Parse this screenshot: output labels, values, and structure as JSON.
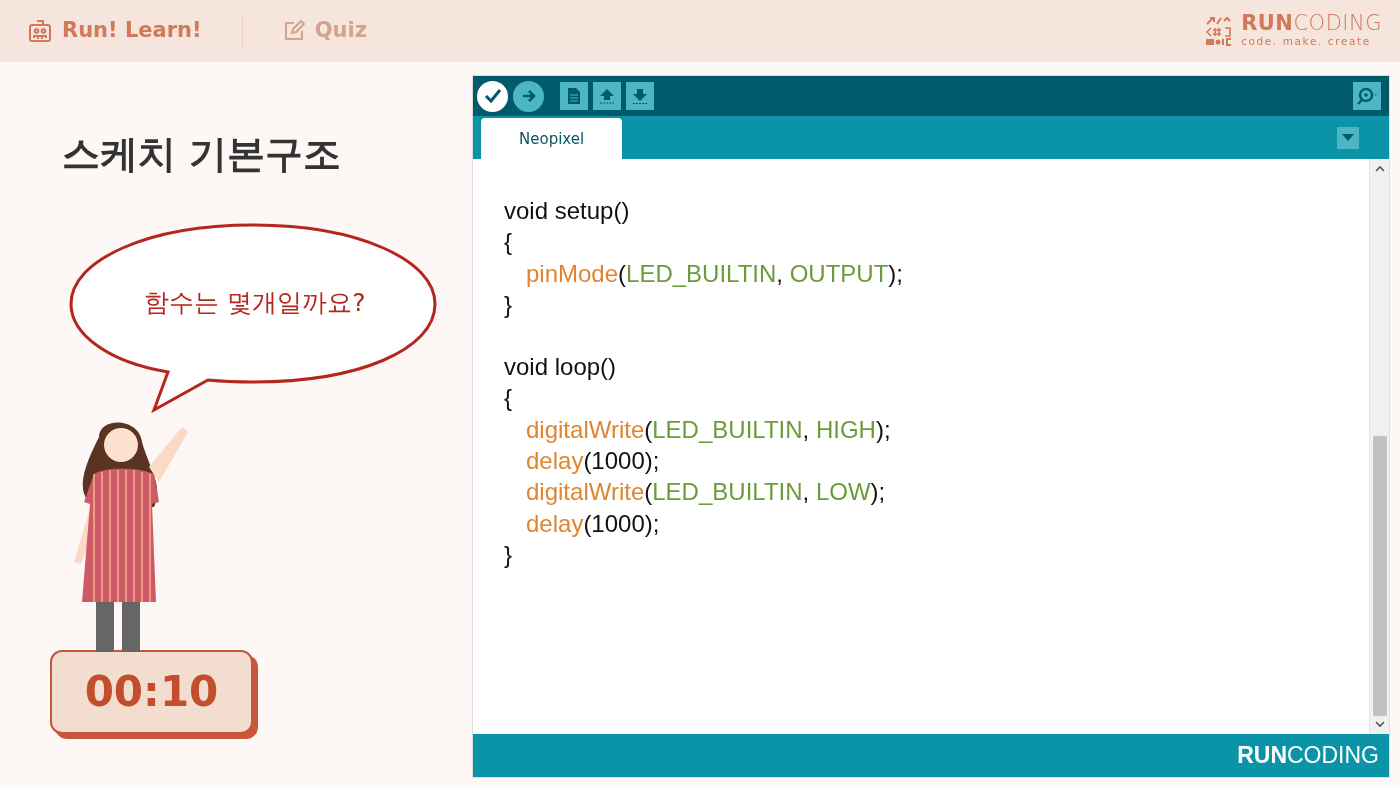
{
  "header": {
    "tabs": [
      {
        "label": "Run! Learn!",
        "selected": true
      },
      {
        "label": "Quiz",
        "selected": false
      }
    ],
    "logo": {
      "name": "**RUN**CODING",
      "tagline": "code. make. create"
    }
  },
  "lesson": {
    "title": "스케치 기본구조",
    "question": "함수는 몇개일까요?",
    "timer": "00:10"
  },
  "editor": {
    "tabs": [
      {
        "label": "Neopixel",
        "selected": true
      }
    ],
    "code": [
      {
        "signature": "void setup()",
        "open": "{",
        "close": "}",
        "body": [
          [
            {
              "text": "pinMode",
              "kind": "function"
            },
            {
              "text": "(",
              "kind": "plain"
            },
            {
              "text": "LED_BUILTIN",
              "kind": "constant"
            },
            {
              "text": ", ",
              "kind": "plain"
            },
            {
              "text": "OUTPUT",
              "kind": "constant"
            },
            {
              "text": ");",
              "kind": "plain"
            }
          ]
        ]
      },
      {
        "signature": "void loop()",
        "open": "{",
        "close": "}",
        "body": [
          [
            {
              "text": "digitalWrite",
              "kind": "function"
            },
            {
              "text": "(",
              "kind": "plain"
            },
            {
              "text": "LED_BUILTIN",
              "kind": "constant"
            },
            {
              "text": ", ",
              "kind": "plain"
            },
            {
              "text": "HIGH",
              "kind": "constant"
            },
            {
              "text": ");",
              "kind": "plain"
            }
          ],
          [
            {
              "text": "delay",
              "kind": "function"
            },
            {
              "text": "(1000);",
              "kind": "plain"
            }
          ],
          [
            {
              "text": "digitalWrite",
              "kind": "function"
            },
            {
              "text": "(",
              "kind": "plain"
            },
            {
              "text": "LED_BUILTIN",
              "kind": "constant"
            },
            {
              "text": ", ",
              "kind": "plain"
            },
            {
              "text": "LOW",
              "kind": "constant"
            },
            {
              "text": ");",
              "kind": "plain"
            }
          ],
          [
            {
              "text": "delay",
              "kind": "function"
            },
            {
              "text": "(1000);",
              "kind": "plain"
            }
          ]
        ]
      }
    ],
    "footer_logo": "**RUN**CODING"
  }
}
